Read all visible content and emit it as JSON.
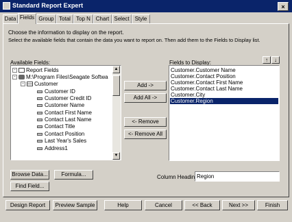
{
  "window": {
    "title": "Standard Report Expert",
    "close_glyph": "×"
  },
  "tabs": [
    {
      "label": "Data"
    },
    {
      "label": "Fields"
    },
    {
      "label": "Group"
    },
    {
      "label": "Total"
    },
    {
      "label": "Top N"
    },
    {
      "label": "Chart"
    },
    {
      "label": "Select"
    },
    {
      "label": "Style"
    }
  ],
  "active_tab": "Fields",
  "instructions": {
    "line1": "Choose the information to display on the report.",
    "line2": "Select the available fields that contain the data you want to report on. Then add them to the Fields to Display list."
  },
  "available_fields": {
    "label": "Available Fields:",
    "tree": [
      {
        "label": "Report Fields",
        "icon": "report-fields-icon",
        "expander": "-"
      },
      {
        "label": "M:\\Program Files\\Seagate Softwa",
        "icon": "database-icon",
        "expander": "-"
      },
      {
        "label": "Customer",
        "icon": "table-icon",
        "expander": "-"
      },
      {
        "label": "Customer ID",
        "icon": "field-icon"
      },
      {
        "label": "Customer Credit ID",
        "icon": "field-icon"
      },
      {
        "label": "Customer Name",
        "icon": "field-icon"
      },
      {
        "label": "Contact First Name",
        "icon": "field-icon"
      },
      {
        "label": "Contact Last Name",
        "icon": "field-icon"
      },
      {
        "label": "Contact Title",
        "icon": "field-icon"
      },
      {
        "label": "Contact Position",
        "icon": "field-icon"
      },
      {
        "label": "Last Year's Sales",
        "icon": "field-icon"
      },
      {
        "label": "Address1",
        "icon": "field-icon"
      }
    ]
  },
  "fields_to_display": {
    "label": "Fields to Display:",
    "items": [
      "Customer.Customer Name",
      "Customer.Contact Position",
      "Customer.Contact First Name",
      "Customer.Contact Last Name",
      "Customer.City",
      "Customer.Region"
    ],
    "selected_index": 5,
    "move_up_glyph": "↑",
    "move_down_glyph": "↓"
  },
  "middle_buttons": {
    "add": "Add ->",
    "add_all": "Add All ->",
    "remove": "<- Remove",
    "remove_all": "<- Remove All"
  },
  "lower_buttons": {
    "browse_data": "Browse Data...",
    "formula": "Formula...",
    "find_field": "Find Field..."
  },
  "column_heading": {
    "label": "Column Heading:",
    "value": "Region"
  },
  "footer": {
    "design_report": "Design Report",
    "preview_sample": "Preview Sample",
    "help": "Help",
    "cancel": "Cancel",
    "back": "<< Back",
    "next": "Next >>",
    "finish": "Finish"
  }
}
